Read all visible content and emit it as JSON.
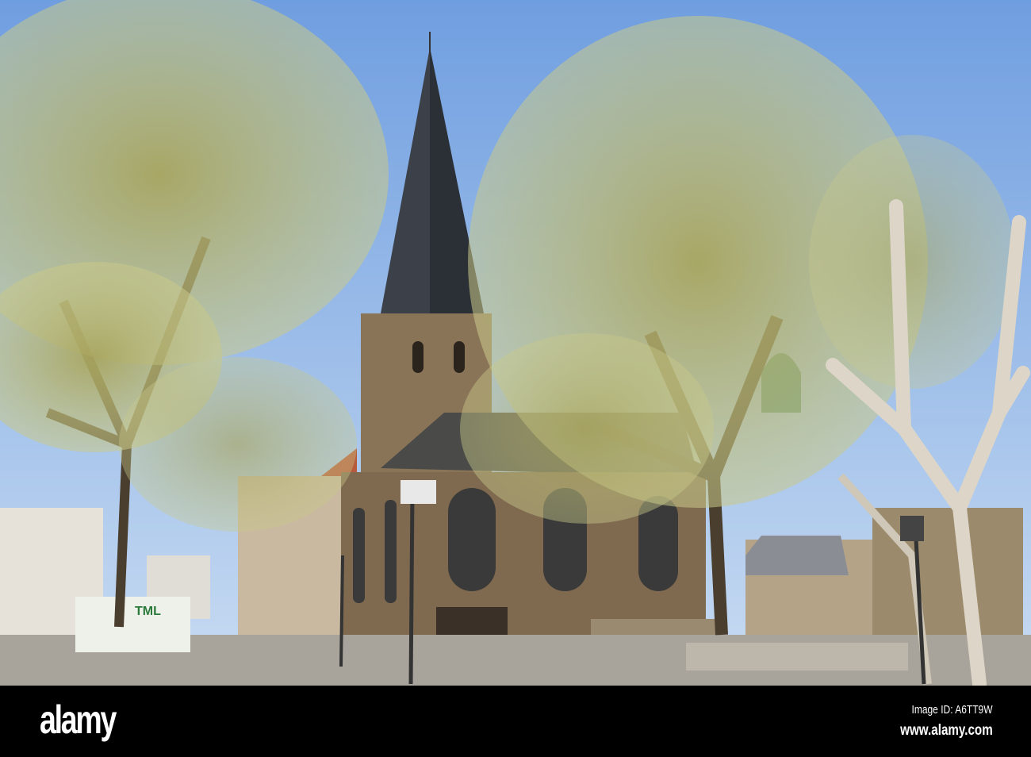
{
  "photo": {
    "subject": "Church with spire among spring trees on a city square",
    "colors": {
      "sky_top": "#6f9ee0",
      "sky_bottom": "#c9dcf2",
      "foliage": "#b8b870",
      "stone": "#8a7458",
      "roof": "#3c4048",
      "pavement": "#a8a39b"
    },
    "sign_text": "TML"
  },
  "footer": {
    "logo": "alamy",
    "image_id": "Image ID: A6TT9W",
    "website": "www.alamy.com"
  }
}
